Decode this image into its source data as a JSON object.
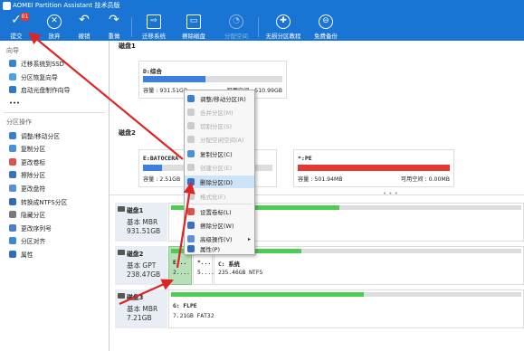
{
  "app": {
    "title": "AOMEI Partition Assistant 技术员版"
  },
  "toolbar": {
    "pending_count": "01",
    "items": [
      {
        "label": "提交",
        "icon": "check-icon",
        "glyph": "✓",
        "enabled": true
      },
      {
        "label": "放弃",
        "icon": "discard-icon",
        "glyph": "✕",
        "enabled": true
      },
      {
        "label": "撤销",
        "icon": "undo-icon",
        "glyph": "↶",
        "enabled": true
      },
      {
        "label": "重做",
        "icon": "redo-icon",
        "glyph": "↷",
        "enabled": true
      },
      {
        "label": "迁移系统",
        "icon": "migrate-system-icon",
        "glyph": "⇨",
        "enabled": true
      },
      {
        "label": "擦除磁盘",
        "icon": "wipe-disk-icon",
        "glyph": "▭",
        "enabled": true
      },
      {
        "label": "分配空间",
        "icon": "allocate-space-icon",
        "glyph": "◔",
        "enabled": false
      },
      {
        "label": "无损分区教程",
        "icon": "shield-icon",
        "glyph": "✚",
        "enabled": true
      },
      {
        "label": "免费备份",
        "icon": "backup-icon",
        "glyph": "⊖",
        "enabled": true
      }
    ]
  },
  "sidebar": {
    "wizard_title": "向导",
    "wizard_items": [
      {
        "label": "迁移系统到SSD",
        "color": "#3b82d6"
      },
      {
        "label": "分区恢复向导",
        "color": "#4aa3e8"
      },
      {
        "label": "启动光盘制作向导",
        "color": "#2e7bc7"
      }
    ],
    "more": "•••",
    "ops_title": "分区操作",
    "ops_items": [
      {
        "label": "调整/移动分区",
        "color": "#3a7fd0"
      },
      {
        "label": "复制分区",
        "color": "#4a90d9"
      },
      {
        "label": "更改卷标",
        "color": "#d9534f"
      },
      {
        "label": "擦除分区",
        "color": "#3b6fc4"
      },
      {
        "label": "更改盘符",
        "color": "#5b8fd6"
      },
      {
        "label": "转换成NTFS分区",
        "color": "#2f6db3"
      },
      {
        "label": "隐藏分区",
        "color": "#7a7a7a"
      },
      {
        "label": "更改序列号",
        "color": "#4a7ec9"
      },
      {
        "label": "分区对齐",
        "color": "#3a8ad8"
      },
      {
        "label": "属性",
        "color": "#2c6fc0"
      }
    ]
  },
  "upper": {
    "disk1_label": "磁盘1",
    "disk2_label": "磁盘2",
    "d_card": {
      "name": "D:综合",
      "cap": "容量 : 931.51GB",
      "free": "可用空间 : 510.99GB",
      "fill": 0.45,
      "color": "#3b7fe0"
    },
    "e_card": {
      "name": "E:BATOCERA",
      "cap": "容量 : 2.51GB",
      "free": "",
      "fill": 0.15,
      "color": "#3b7fe0"
    },
    "pe_card": {
      "name": "*:PE",
      "cap": "容量 : 501.94MB",
      "free": "可用空间 : 0.00MB",
      "fill": 1.0,
      "color": "#e53935"
    },
    "dots": "• • •"
  },
  "context_menu": {
    "items": [
      {
        "label": "调整/移动分区(R)",
        "enabled": true,
        "color": "#3a7fd0"
      },
      {
        "label": "合并分区(M)",
        "enabled": false
      },
      {
        "label": "切割分区(S)",
        "enabled": false
      },
      {
        "label": "分配空闲空间(A)",
        "enabled": false
      },
      {
        "label": "复制分区(C)",
        "enabled": true,
        "color": "#4a90d9"
      },
      {
        "label": "创建分区(E)",
        "enabled": false
      },
      {
        "label": "删除分区(D)",
        "enabled": true,
        "highlight": true,
        "color": "#3b6fc4"
      },
      {
        "label": "格式化(F)",
        "enabled": false
      },
      {
        "label": "设置卷标(L)",
        "enabled": true,
        "color": "#d9534f"
      },
      {
        "label": "擦除分区(W)",
        "enabled": true,
        "color": "#3b6fc4"
      },
      {
        "label": "高级操作(V)",
        "enabled": true,
        "color": "#5b8fd6",
        "submenu": "▸"
      },
      {
        "label": "属性(P)",
        "enabled": true,
        "color": "#2c6fc0"
      }
    ]
  },
  "disks": [
    {
      "name": "磁盘1",
      "type": "基本 MBR",
      "size": "931.51GB",
      "partitions": [
        {
          "name": "",
          "info": "",
          "fill": 0.48
        }
      ]
    },
    {
      "name": "磁盘2",
      "type": "基本 GPT",
      "size": "238.47GB",
      "partitions": [
        {
          "name": "E...",
          "info": "2....",
          "fill": 0.7,
          "selected": true
        },
        {
          "name": "*...",
          "info": "5....",
          "fill": 1.0
        },
        {
          "name": "C: 系统",
          "info": "235.46GB NTFS",
          "fill": 0.28
        }
      ]
    },
    {
      "name": "磁盘3",
      "type": "基本 MBR",
      "size": "7.21GB",
      "partitions": [
        {
          "name": "G: FLPE",
          "info": "7.21GB FAT32",
          "fill": 0.55
        }
      ]
    }
  ],
  "colors": {
    "accent": "#1a74d4",
    "used_green": "#4ccc52",
    "arrow_red": "#e02424"
  }
}
